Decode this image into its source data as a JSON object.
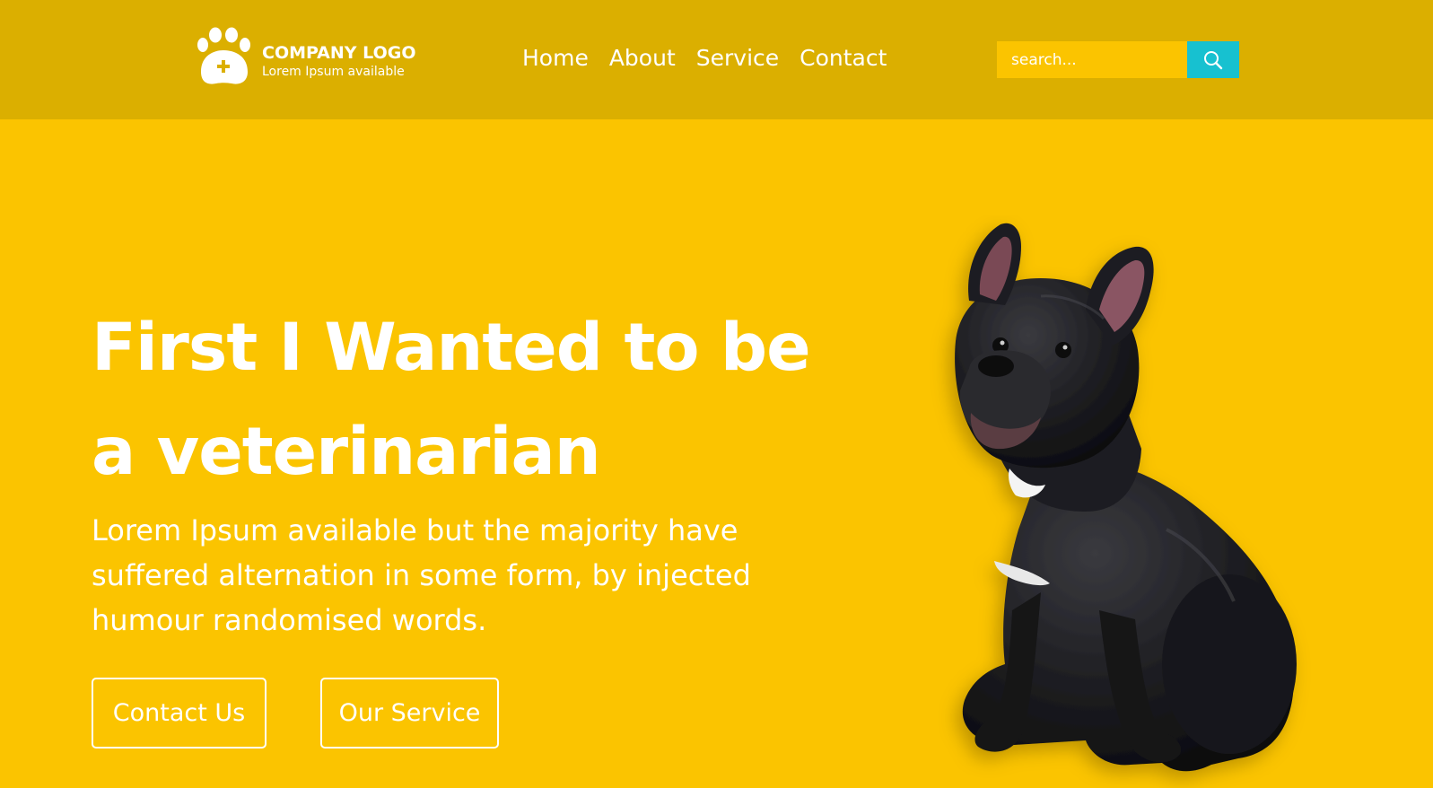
{
  "header": {
    "logo": {
      "title": "COMPANY LOGO",
      "subtitle": "Lorem Ipsum available",
      "icon": "paw-plus-icon"
    },
    "nav": [
      {
        "label": "Home"
      },
      {
        "label": "About"
      },
      {
        "label": "Service"
      },
      {
        "label": "Contact"
      }
    ],
    "search": {
      "placeholder": "search...",
      "value": "",
      "icon": "search-icon"
    }
  },
  "hero": {
    "heading": "First I Wanted to be a veterinarian",
    "text": "Lorem Ipsum available but the majority have suffered alternation in some form, by injected humour randomised words.",
    "buttons": {
      "contact": "Contact Us",
      "service": "Our Service"
    },
    "image": "french-bulldog-image"
  },
  "colors": {
    "background": "#fbc400",
    "header": "#dbaf00",
    "search_button": "#17c1d0",
    "text": "#ffffff"
  }
}
